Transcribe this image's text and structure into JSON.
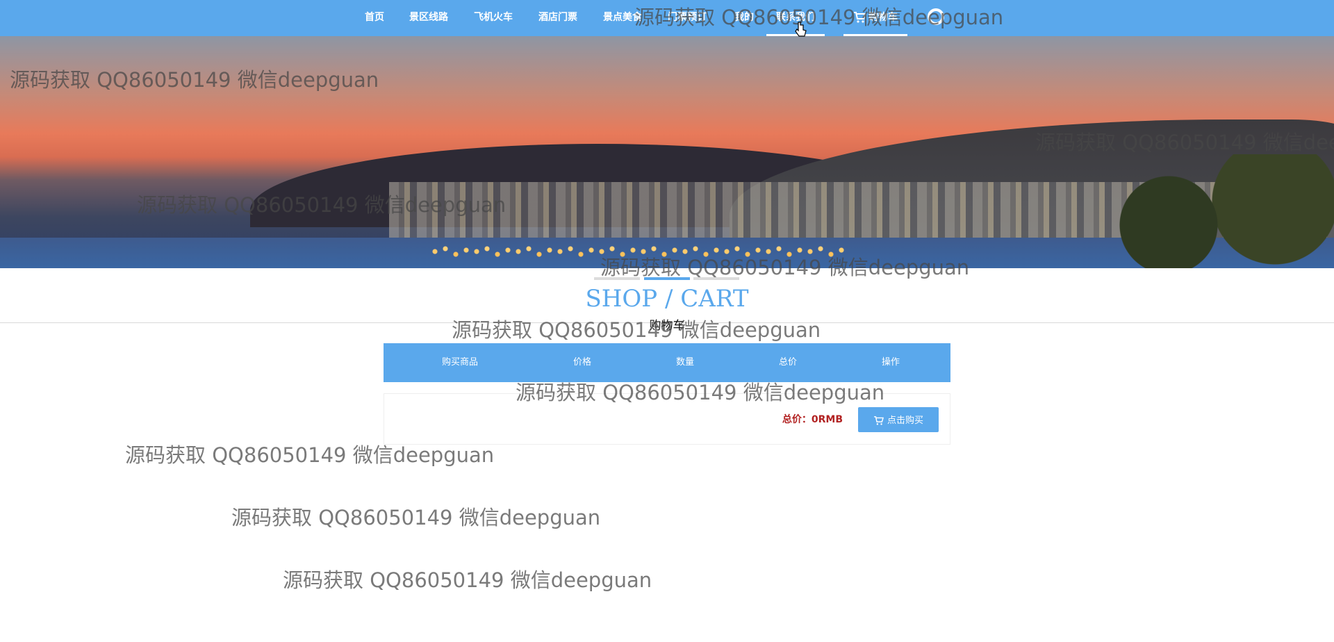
{
  "nav": {
    "items": [
      "首页",
      "景区线路",
      "飞机火车",
      "酒店门票",
      "景点美食",
      "门票预订",
      "我的",
      "联系我们"
    ],
    "cart_label": "购物车",
    "search_icon": "search-icon",
    "active_index": 7
  },
  "banner": {
    "image": "seaside-town-at-sunset"
  },
  "section": {
    "title": "SHOP / CART",
    "subtitle": "购物车"
  },
  "cart": {
    "columns": [
      "购买商品",
      "价格",
      "数量",
      "总价",
      "操作"
    ],
    "total_label": "总价：0RMB",
    "buy_button": "点击购买",
    "buy_icon": "cart-icon"
  },
  "watermark": "源码获取 QQ86050149 微信deepguan",
  "colors": {
    "primary": "#5aa8ec",
    "total_text": "#b22222"
  }
}
